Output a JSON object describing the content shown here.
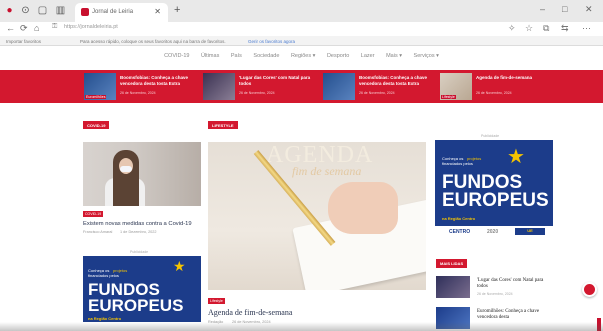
{
  "browser": {
    "tab_title": "Jornal de Leiria",
    "new_tab": "+",
    "window_controls": [
      "–",
      "□",
      "✕"
    ],
    "nav": [
      "←",
      "⟳",
      "⌂"
    ],
    "url": "https://jornaldeleiria.pt",
    "toolbar_icons": [
      "✧",
      "☆",
      "⧉",
      "⇆",
      "⋯"
    ],
    "favbar_folder": "Importar favoritos",
    "favbar_text": "Para acesso rápido, coloque os seus favoritos aqui na barra de favoritos.",
    "favbar_link": "Gerir os favoritos agora"
  },
  "site": {
    "nav": [
      "COVID-19",
      "Últimas",
      "País",
      "Sociedade",
      "Regiões ▾",
      "Desporto",
      "Lazer",
      "Mais ▾",
      "Serviços ▾"
    ],
    "strip": [
      {
        "title": "Boomsfobias: Conheça a chave vencedora desta tosta Extra",
        "date": "26 de Novembro, 2024",
        "tag": "Euromilhões"
      },
      {
        "title": "'Lugar das Cores' com Natal para todos",
        "date": "26 de Novembro, 2024",
        "tag": ""
      },
      {
        "title": "Boomsfobias: Conheça a chave vencedora desta tosta Extra",
        "date": "26 de Novembro, 2024",
        "tag": ""
      },
      {
        "title": "Agenda de fim-de-semana",
        "date": "26 de Novembro, 2024",
        "tag": "Lifestyle"
      }
    ],
    "covid": {
      "badge": "COVID-19",
      "tag": "COVID-19",
      "title": "Existem novas medidas contra a Covid-19",
      "author": "Francisco Amaral",
      "date": "1 de Dezembro, 2022"
    },
    "lifestyle": {
      "badge": "LIFESTYLE",
      "image_title": "AGENDA",
      "image_subtitle": "fim de semana",
      "tag": "Lifestyle",
      "title": "Agenda de fim-de-semana",
      "author": "Redação",
      "date": "26 de Novembro, 2024"
    },
    "ads": {
      "label": "Publicidade",
      "small": [
        "Conheça os",
        "projetos",
        "financiados pelos"
      ],
      "big_1": "FUNDOS",
      "big_2": "EUROPEUS",
      "regiao": "na Região Centro",
      "logos": [
        "CENTRO",
        "2020",
        "UE"
      ]
    },
    "mais_lidas": {
      "badge": "MAIS LIDAS",
      "items": [
        {
          "title": "'Lugar das Cores' com Natal para todos",
          "date": "26 de Novembro, 2024"
        },
        {
          "title": "Euromilhões: Conheça a chave vencedora desta",
          "date": ""
        }
      ]
    },
    "colors": {
      "brand_red": "#d3182f",
      "eu_blue": "#1c3c8a",
      "eu_yellow": "#f5c400"
    }
  }
}
